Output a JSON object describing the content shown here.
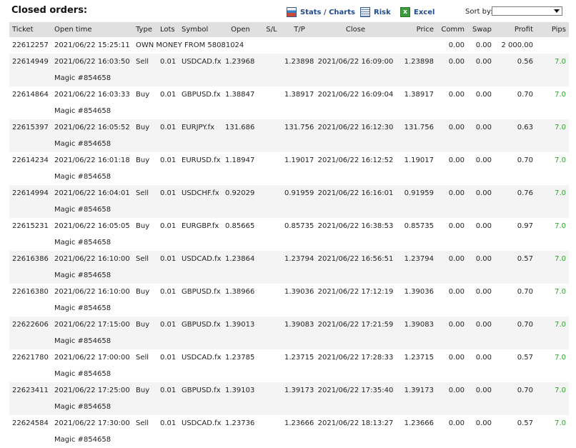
{
  "header": {
    "title": "Closed orders:",
    "stats_label": "Stats / Charts",
    "risk_label": "Risk",
    "excel_label": "Excel",
    "sort_label": "Sort by:",
    "sort_value": ""
  },
  "columns": [
    "Ticket",
    "Open time",
    "Type",
    "Lots",
    "Symbol",
    "Open",
    "S/L",
    "T/P",
    "Close",
    "Price",
    "Comm",
    "Swap",
    "Profit",
    "Pips"
  ],
  "deposit": {
    "ticket": "22612257",
    "time": "2021/06/22 15:25:11",
    "desc": "OWN MONEY FROM 58081024",
    "comm": "0.00",
    "swap": "0.00",
    "profit": "2 000.00"
  },
  "orders": [
    {
      "ticket": "22614949",
      "open_time": "2021/06/22 16:03:50",
      "type": "Sell",
      "lots": "0.01",
      "symbol": "USDCAD.fx",
      "open": "1.23968",
      "sl": "",
      "tp": "1.23898",
      "close": "2021/06/22 16:09:00",
      "price": "1.23898",
      "comm": "0.00",
      "swap": "0.00",
      "profit": "0.56",
      "pips": "7.0",
      "magic": "Magic #854658"
    },
    {
      "ticket": "22614864",
      "open_time": "2021/06/22 16:03:33",
      "type": "Buy",
      "lots": "0.01",
      "symbol": "GBPUSD.fx",
      "open": "1.38847",
      "sl": "",
      "tp": "1.38917",
      "close": "2021/06/22 16:09:04",
      "price": "1.38917",
      "comm": "0.00",
      "swap": "0.00",
      "profit": "0.70",
      "pips": "7.0",
      "magic": "Magic #854658"
    },
    {
      "ticket": "22615397",
      "open_time": "2021/06/22 16:05:52",
      "type": "Buy",
      "lots": "0.01",
      "symbol": "EURJPY.fx",
      "open": "131.686",
      "sl": "",
      "tp": "131.756",
      "close": "2021/06/22 16:12:30",
      "price": "131.756",
      "comm": "0.00",
      "swap": "0.00",
      "profit": "0.63",
      "pips": "7.0",
      "magic": "Magic #854658"
    },
    {
      "ticket": "22614234",
      "open_time": "2021/06/22 16:01:18",
      "type": "Buy",
      "lots": "0.01",
      "symbol": "EURUSD.fx",
      "open": "1.18947",
      "sl": "",
      "tp": "1.19017",
      "close": "2021/06/22 16:12:52",
      "price": "1.19017",
      "comm": "0.00",
      "swap": "0.00",
      "profit": "0.70",
      "pips": "7.0",
      "magic": "Magic #854658"
    },
    {
      "ticket": "22614994",
      "open_time": "2021/06/22 16:04:01",
      "type": "Sell",
      "lots": "0.01",
      "symbol": "USDCHF.fx",
      "open": "0.92029",
      "sl": "",
      "tp": "0.91959",
      "close": "2021/06/22 16:16:01",
      "price": "0.91959",
      "comm": "0.00",
      "swap": "0.00",
      "profit": "0.76",
      "pips": "7.0",
      "magic": "Magic #854658"
    },
    {
      "ticket": "22615231",
      "open_time": "2021/06/22 16:05:05",
      "type": "Buy",
      "lots": "0.01",
      "symbol": "EURGBP.fx",
      "open": "0.85665",
      "sl": "",
      "tp": "0.85735",
      "close": "2021/06/22 16:38:53",
      "price": "0.85735",
      "comm": "0.00",
      "swap": "0.00",
      "profit": "0.97",
      "pips": "7.0",
      "magic": "Magic #854658"
    },
    {
      "ticket": "22616386",
      "open_time": "2021/06/22 16:10:00",
      "type": "Sell",
      "lots": "0.01",
      "symbol": "USDCAD.fx",
      "open": "1.23864",
      "sl": "",
      "tp": "1.23794",
      "close": "2021/06/22 16:56:51",
      "price": "1.23794",
      "comm": "0.00",
      "swap": "0.00",
      "profit": "0.57",
      "pips": "7.0",
      "magic": "Magic #854658"
    },
    {
      "ticket": "22616380",
      "open_time": "2021/06/22 16:10:00",
      "type": "Buy",
      "lots": "0.01",
      "symbol": "GBPUSD.fx",
      "open": "1.38966",
      "sl": "",
      "tp": "1.39036",
      "close": "2021/06/22 17:12:19",
      "price": "1.39036",
      "comm": "0.00",
      "swap": "0.00",
      "profit": "0.70",
      "pips": "7.0",
      "magic": "Magic #854658"
    },
    {
      "ticket": "22622606",
      "open_time": "2021/06/22 17:15:00",
      "type": "Buy",
      "lots": "0.01",
      "symbol": "GBPUSD.fx",
      "open": "1.39013",
      "sl": "",
      "tp": "1.39083",
      "close": "2021/06/22 17:21:59",
      "price": "1.39083",
      "comm": "0.00",
      "swap": "0.00",
      "profit": "0.70",
      "pips": "7.0",
      "magic": "Magic #854658"
    },
    {
      "ticket": "22621780",
      "open_time": "2021/06/22 17:00:00",
      "type": "Sell",
      "lots": "0.01",
      "symbol": "USDCAD.fx",
      "open": "1.23785",
      "sl": "",
      "tp": "1.23715",
      "close": "2021/06/22 17:28:33",
      "price": "1.23715",
      "comm": "0.00",
      "swap": "0.00",
      "profit": "0.57",
      "pips": "7.0",
      "magic": "Magic #854658"
    },
    {
      "ticket": "22623411",
      "open_time": "2021/06/22 17:25:00",
      "type": "Buy",
      "lots": "0.01",
      "symbol": "GBPUSD.fx",
      "open": "1.39103",
      "sl": "",
      "tp": "1.39173",
      "close": "2021/06/22 17:35:40",
      "price": "1.39173",
      "comm": "0.00",
      "swap": "0.00",
      "profit": "0.70",
      "pips": "7.0",
      "magic": "Magic #854658"
    },
    {
      "ticket": "22624584",
      "open_time": "2021/06/22 17:30:00",
      "type": "Sell",
      "lots": "0.01",
      "symbol": "USDCAD.fx",
      "open": "1.23736",
      "sl": "",
      "tp": "1.23666",
      "close": "2021/06/22 18:13:27",
      "price": "1.23666",
      "comm": "0.00",
      "swap": "0.00",
      "profit": "0.57",
      "pips": "7.0",
      "magic": "Magic #854658"
    }
  ],
  "colors": {
    "header_bg": "#e0e0e0",
    "alt_row_bg": "#f4f4f4",
    "link": "#1f4a8c",
    "pips_positive": "#2ea52e"
  }
}
